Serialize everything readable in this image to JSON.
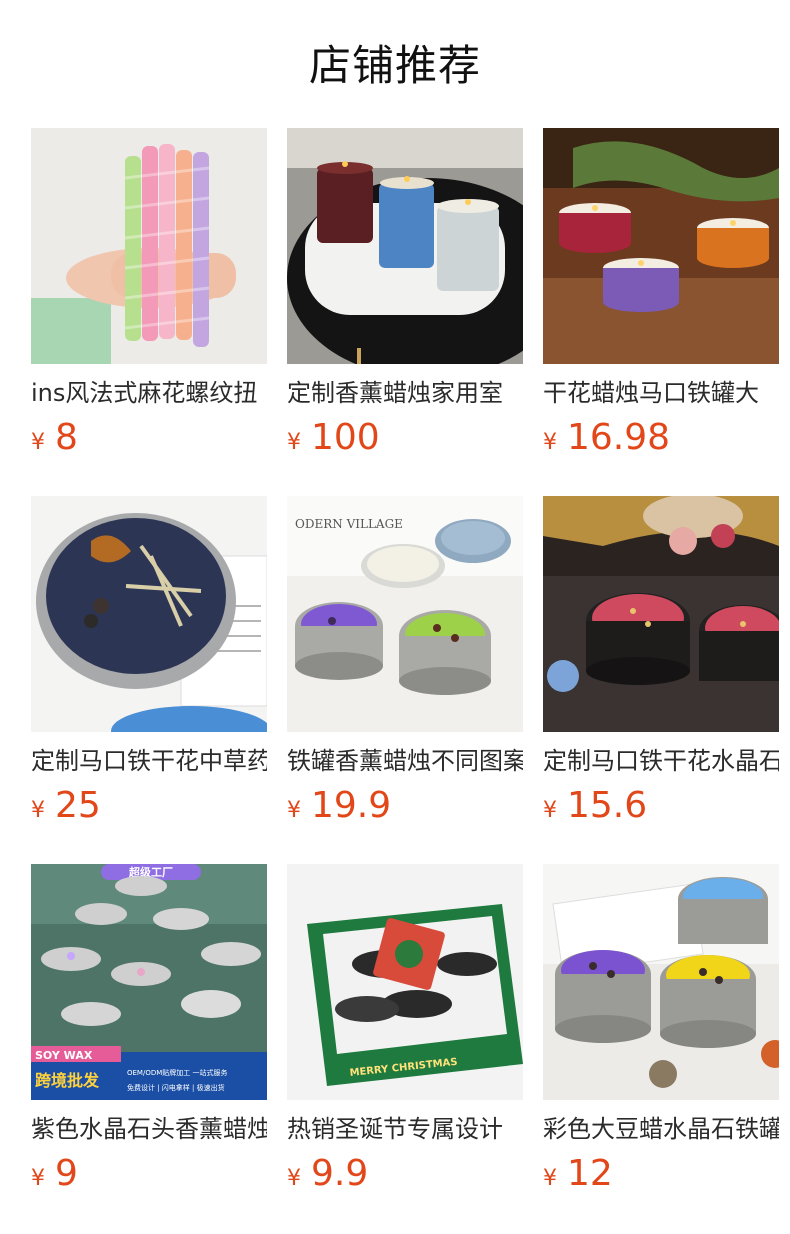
{
  "header": {
    "title": "店铺推荐"
  },
  "products": [
    {
      "title": "ins风法式麻花螺纹扭",
      "currency": "¥",
      "price": "8",
      "image": "twisted-pastel-taper-candles"
    },
    {
      "title": "定制香薰蜡烛家用室",
      "currency": "¥",
      "price": "100",
      "image": "three-jar-candles-on-tray"
    },
    {
      "title": "干花蜡烛马口铁罐大",
      "currency": "¥",
      "price": "16.98",
      "image": "tin-candles-on-wood"
    },
    {
      "title": "定制马口铁干花中草药",
      "currency": "¥",
      "price": "25",
      "image": "herbal-tin-candle"
    },
    {
      "title": "铁罐香薰蜡烛不同图案",
      "currency": "¥",
      "price": "19.9",
      "image": "colorful-tin-candles-village"
    },
    {
      "title": "定制马口铁干花水晶石",
      "currency": "¥",
      "price": "15.6",
      "image": "rose-petal-tin-candles"
    },
    {
      "title": "紫色水晶石头香薰蜡烛",
      "currency": "¥",
      "price": "9",
      "image": "crystal-tin-candles-factory",
      "badge": {
        "top": "超级工厂",
        "soy": "SOY WAX",
        "main": "跨境批发",
        "line1": "OEM/ODM贴牌加工 一站式服务",
        "line2": "免费设计 | 闪电拿样 | 极速出货"
      }
    },
    {
      "title": "热销圣诞节专属设计",
      "currency": "¥",
      "price": "9.9",
      "image": "christmas-tin-candles-box",
      "box_text": "MERRY CHRISTMAS"
    },
    {
      "title": "彩色大豆蜡水晶石铁罐",
      "currency": "¥",
      "price": "12",
      "image": "colorful-soy-crystal-candles"
    }
  ],
  "colors": {
    "price": "#e2471a",
    "title": "#111111",
    "text": "#2b2b2b"
  }
}
